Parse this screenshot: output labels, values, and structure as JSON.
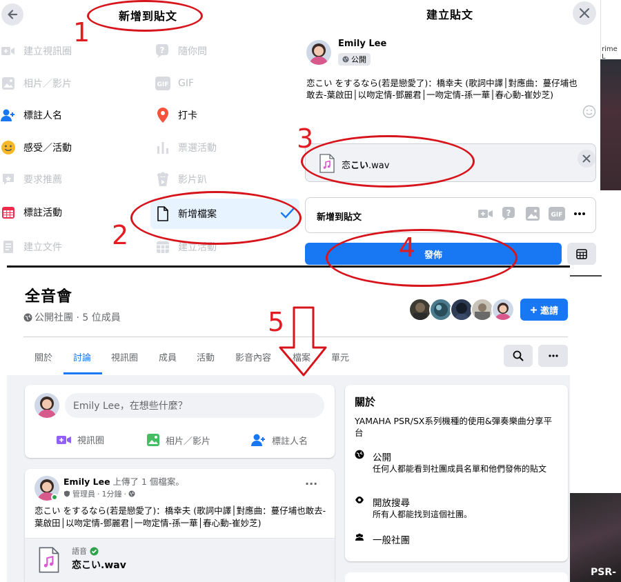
{
  "left_panel": {
    "title": "新增到貼文",
    "options": [
      {
        "label": "建立視訊圈",
        "icon": "video-camera-icon",
        "enabled": false
      },
      {
        "label": "隨你問",
        "icon": "question-icon",
        "enabled": false
      },
      {
        "label": "相片／影片",
        "icon": "photo-icon",
        "enabled": false
      },
      {
        "label": "GIF",
        "icon": "gif-icon",
        "enabled": false
      },
      {
        "label": "標註人名",
        "icon": "tag-people-icon",
        "enabled": true
      },
      {
        "label": "打卡",
        "icon": "location-pin-icon",
        "enabled": true
      },
      {
        "label": "感受／活動",
        "icon": "smiley-icon",
        "enabled": true
      },
      {
        "label": "票選活動",
        "icon": "poll-icon",
        "enabled": false
      },
      {
        "label": "要求推薦",
        "icon": "recommend-icon",
        "enabled": false
      },
      {
        "label": "影片趴",
        "icon": "popcorn-icon",
        "enabled": false
      },
      {
        "label": "標註活動",
        "icon": "calendar-icon",
        "enabled": true
      },
      {
        "label": "新增檔案",
        "icon": "file-icon",
        "enabled": true,
        "selected": true
      },
      {
        "label": "建立文件",
        "icon": "document-icon",
        "enabled": false
      },
      {
        "label": "建立活動",
        "icon": "event-icon",
        "enabled": false
      }
    ]
  },
  "right_panel": {
    "title": "建立貼文",
    "author": "Emily Lee",
    "privacy": "公開",
    "post_text": "恋こい をするなら(若是戀愛了)：橋幸夫 (歌詞中譯│對應曲：蔓仔埔也敢去-葉啟田│以吻定情-鄧麗君│一吻定情-孫一華│春心動-崔妙芝)",
    "file_prefix": "恋",
    "file_bold": "こい",
    "file_ext": ".wav",
    "add_to_post_label": "新增到貼文",
    "post_button": "發佈"
  },
  "group_page": {
    "name": "全音會",
    "meta": "公開社團 · 5 位成員",
    "invite_label": "邀請",
    "tabs": [
      "關於",
      "討論",
      "視訊圈",
      "成員",
      "活動",
      "影音內容",
      "檔案",
      "單元"
    ],
    "active_tab": "討論",
    "composer": {
      "placeholder": "Emily Lee，在想些什麼？",
      "actions": [
        "視訊圈",
        "相片／影片",
        "標註人名"
      ]
    },
    "post": {
      "author": "Emily Lee",
      "action": " 上傳了 1 個檔案。",
      "role": "管理員",
      "time": "1分鐘",
      "text": "恋こい をするなら(若是戀愛了)：橋幸夫 (歌詞中譯│對應曲：蔓仔埔也敢去-葉啟田│以吻定情-鄧麗君│一吻定情-孫一華│春心動-崔妙芝)",
      "file_type": "語音",
      "file_prefix": "恋",
      "file_bold": "こい",
      "file_ext": ".wav"
    },
    "about": {
      "title": "關於",
      "description": "YAMAHA PSR/SX系列機種的使用&彈奏樂曲分享平台",
      "privacy_title": "公開",
      "privacy_desc": "任何人都能看到社團成員名單和他們發佈的貼文",
      "visible_title": "開放搜尋",
      "visible_desc": "所有人都能找到這個社團。",
      "type_title": "一般社團"
    }
  },
  "background": {
    "fragment_text": "rime L",
    "fragment_text2": "PSR-"
  },
  "annotations": [
    "1",
    "2",
    "3",
    "4",
    "5"
  ],
  "colors": {
    "accent": "#1877f2",
    "annotation": "#e31b23",
    "selected_bg": "#e7f3ff"
  }
}
